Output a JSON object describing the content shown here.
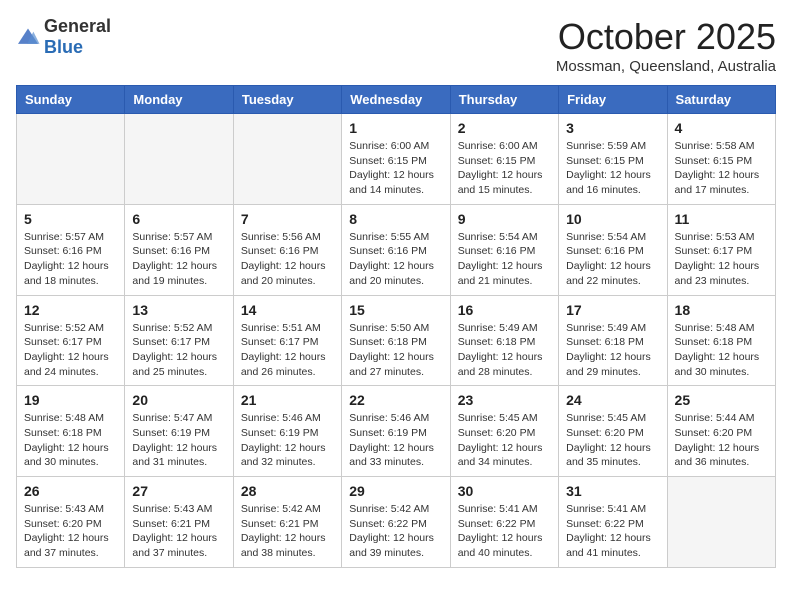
{
  "header": {
    "logo_general": "General",
    "logo_blue": "Blue",
    "month": "October 2025",
    "location": "Mossman, Queensland, Australia"
  },
  "days_of_week": [
    "Sunday",
    "Monday",
    "Tuesday",
    "Wednesday",
    "Thursday",
    "Friday",
    "Saturday"
  ],
  "weeks": [
    [
      {
        "day": "",
        "info": ""
      },
      {
        "day": "",
        "info": ""
      },
      {
        "day": "",
        "info": ""
      },
      {
        "day": "1",
        "info": "Sunrise: 6:00 AM\nSunset: 6:15 PM\nDaylight: 12 hours\nand 14 minutes."
      },
      {
        "day": "2",
        "info": "Sunrise: 6:00 AM\nSunset: 6:15 PM\nDaylight: 12 hours\nand 15 minutes."
      },
      {
        "day": "3",
        "info": "Sunrise: 5:59 AM\nSunset: 6:15 PM\nDaylight: 12 hours\nand 16 minutes."
      },
      {
        "day": "4",
        "info": "Sunrise: 5:58 AM\nSunset: 6:15 PM\nDaylight: 12 hours\nand 17 minutes."
      }
    ],
    [
      {
        "day": "5",
        "info": "Sunrise: 5:57 AM\nSunset: 6:16 PM\nDaylight: 12 hours\nand 18 minutes."
      },
      {
        "day": "6",
        "info": "Sunrise: 5:57 AM\nSunset: 6:16 PM\nDaylight: 12 hours\nand 19 minutes."
      },
      {
        "day": "7",
        "info": "Sunrise: 5:56 AM\nSunset: 6:16 PM\nDaylight: 12 hours\nand 20 minutes."
      },
      {
        "day": "8",
        "info": "Sunrise: 5:55 AM\nSunset: 6:16 PM\nDaylight: 12 hours\nand 20 minutes."
      },
      {
        "day": "9",
        "info": "Sunrise: 5:54 AM\nSunset: 6:16 PM\nDaylight: 12 hours\nand 21 minutes."
      },
      {
        "day": "10",
        "info": "Sunrise: 5:54 AM\nSunset: 6:16 PM\nDaylight: 12 hours\nand 22 minutes."
      },
      {
        "day": "11",
        "info": "Sunrise: 5:53 AM\nSunset: 6:17 PM\nDaylight: 12 hours\nand 23 minutes."
      }
    ],
    [
      {
        "day": "12",
        "info": "Sunrise: 5:52 AM\nSunset: 6:17 PM\nDaylight: 12 hours\nand 24 minutes."
      },
      {
        "day": "13",
        "info": "Sunrise: 5:52 AM\nSunset: 6:17 PM\nDaylight: 12 hours\nand 25 minutes."
      },
      {
        "day": "14",
        "info": "Sunrise: 5:51 AM\nSunset: 6:17 PM\nDaylight: 12 hours\nand 26 minutes."
      },
      {
        "day": "15",
        "info": "Sunrise: 5:50 AM\nSunset: 6:18 PM\nDaylight: 12 hours\nand 27 minutes."
      },
      {
        "day": "16",
        "info": "Sunrise: 5:49 AM\nSunset: 6:18 PM\nDaylight: 12 hours\nand 28 minutes."
      },
      {
        "day": "17",
        "info": "Sunrise: 5:49 AM\nSunset: 6:18 PM\nDaylight: 12 hours\nand 29 minutes."
      },
      {
        "day": "18",
        "info": "Sunrise: 5:48 AM\nSunset: 6:18 PM\nDaylight: 12 hours\nand 30 minutes."
      }
    ],
    [
      {
        "day": "19",
        "info": "Sunrise: 5:48 AM\nSunset: 6:18 PM\nDaylight: 12 hours\nand 30 minutes."
      },
      {
        "day": "20",
        "info": "Sunrise: 5:47 AM\nSunset: 6:19 PM\nDaylight: 12 hours\nand 31 minutes."
      },
      {
        "day": "21",
        "info": "Sunrise: 5:46 AM\nSunset: 6:19 PM\nDaylight: 12 hours\nand 32 minutes."
      },
      {
        "day": "22",
        "info": "Sunrise: 5:46 AM\nSunset: 6:19 PM\nDaylight: 12 hours\nand 33 minutes."
      },
      {
        "day": "23",
        "info": "Sunrise: 5:45 AM\nSunset: 6:20 PM\nDaylight: 12 hours\nand 34 minutes."
      },
      {
        "day": "24",
        "info": "Sunrise: 5:45 AM\nSunset: 6:20 PM\nDaylight: 12 hours\nand 35 minutes."
      },
      {
        "day": "25",
        "info": "Sunrise: 5:44 AM\nSunset: 6:20 PM\nDaylight: 12 hours\nand 36 minutes."
      }
    ],
    [
      {
        "day": "26",
        "info": "Sunrise: 5:43 AM\nSunset: 6:20 PM\nDaylight: 12 hours\nand 37 minutes."
      },
      {
        "day": "27",
        "info": "Sunrise: 5:43 AM\nSunset: 6:21 PM\nDaylight: 12 hours\nand 37 minutes."
      },
      {
        "day": "28",
        "info": "Sunrise: 5:42 AM\nSunset: 6:21 PM\nDaylight: 12 hours\nand 38 minutes."
      },
      {
        "day": "29",
        "info": "Sunrise: 5:42 AM\nSunset: 6:22 PM\nDaylight: 12 hours\nand 39 minutes."
      },
      {
        "day": "30",
        "info": "Sunrise: 5:41 AM\nSunset: 6:22 PM\nDaylight: 12 hours\nand 40 minutes."
      },
      {
        "day": "31",
        "info": "Sunrise: 5:41 AM\nSunset: 6:22 PM\nDaylight: 12 hours\nand 41 minutes."
      },
      {
        "day": "",
        "info": ""
      }
    ]
  ]
}
